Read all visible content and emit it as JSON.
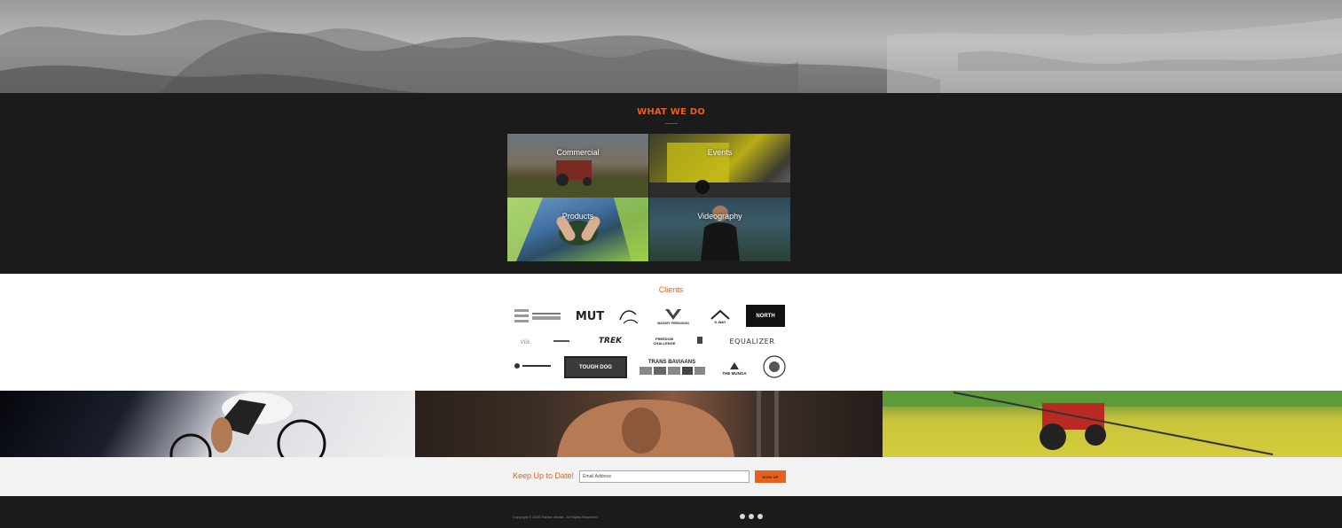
{
  "section_what_we_do": {
    "title": "WHAT WE DO",
    "tiles": [
      {
        "label": "Commercial"
      },
      {
        "label": "Events"
      },
      {
        "label": "Products"
      },
      {
        "label": "Videography"
      }
    ]
  },
  "clients": {
    "title": "Clients",
    "logos": {
      "mut": "MUT",
      "massey": "MASSEY FERGUSON",
      "kway": "K-WAY",
      "north": "NORTH",
      "via": "via.",
      "trek": "TREK",
      "freedom": "FREEDOM CHALLENGE",
      "equalizer": "EQUALIZER",
      "toughdog": "TOUGH DOG",
      "transbaviaans": "TRANS BAVIAANS",
      "munga": "THE MUNGA"
    }
  },
  "newsletter": {
    "label": "Keep Up to Date!",
    "email_placeholder": "Email Address",
    "button_label": "SIGN UP"
  },
  "footer": {
    "copyright": "Copyright © 2020 Robbie Media - All Rights Reserved"
  },
  "icons": [
    "facebook-icon",
    "instagram-icon",
    "youtube-icon"
  ],
  "colors": {
    "accent": "#e8601c",
    "dark_bg": "#1b1b1b",
    "newsletter_bg": "#f2f2f2"
  }
}
